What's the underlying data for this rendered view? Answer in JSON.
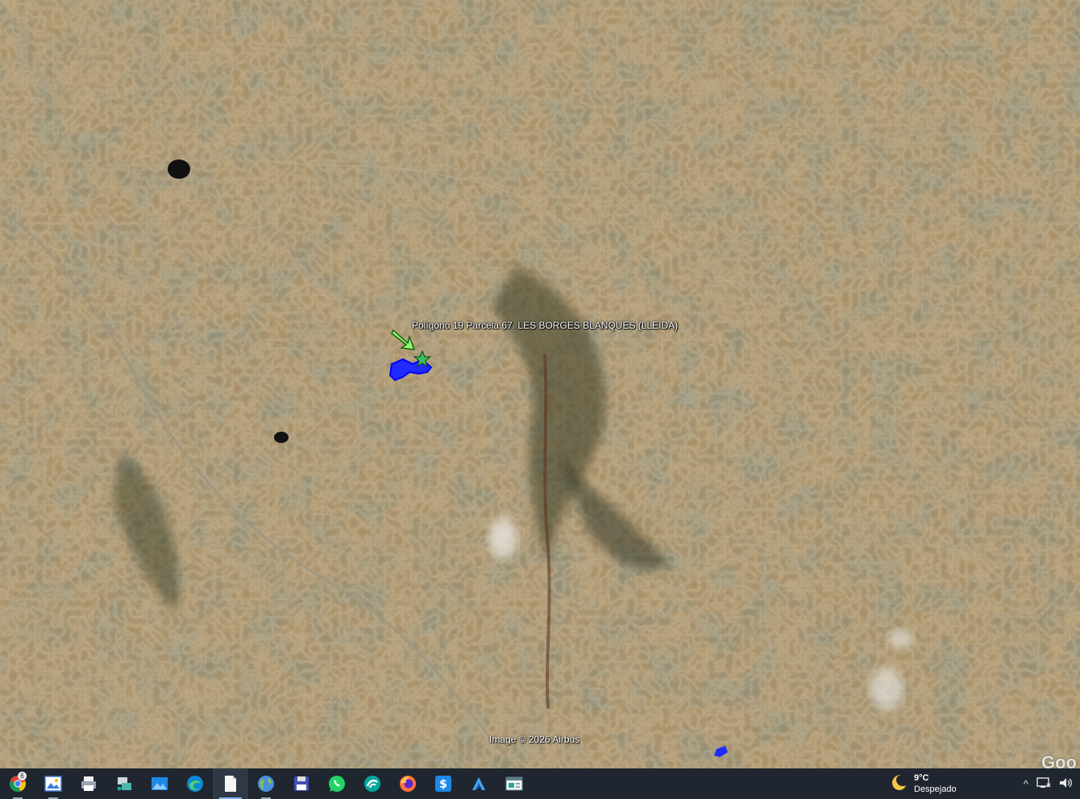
{
  "map": {
    "placemark_label": "Polígono 19 Parcela 67. LES BORGES BLANQUES (LLEIDA)",
    "attribution": "Image © 2026 Airbus",
    "logo_text": "Goo",
    "colors": {
      "parcel": "#1f2bff",
      "arrow": "#6bff5a",
      "terrain": "#a08a62"
    }
  },
  "taskbar": {
    "apps": [
      {
        "name": "Google Chrome",
        "icon": "chrome-icon",
        "badge": "6"
      },
      {
        "name": "Image Viewer",
        "icon": "picture-viewer-icon"
      },
      {
        "name": "Printer",
        "icon": "printer-icon"
      },
      {
        "name": "Network Files",
        "icon": "network-files-icon"
      },
      {
        "name": "Photos",
        "icon": "photos-icon"
      },
      {
        "name": "Microsoft Edge",
        "icon": "edge-icon"
      },
      {
        "name": "Document",
        "icon": "document-icon"
      },
      {
        "name": "Google Earth",
        "icon": "globe-icon"
      },
      {
        "name": "Save",
        "icon": "floppy-icon"
      },
      {
        "name": "WhatsApp",
        "icon": "whatsapp-icon"
      },
      {
        "name": "Signal App",
        "icon": "wave-icon"
      },
      {
        "name": "Firefox",
        "icon": "firefox-icon"
      },
      {
        "name": "Dollar App",
        "icon": "dollar-icon"
      },
      {
        "name": "Arrow App",
        "icon": "arrow-app-icon"
      },
      {
        "name": "Window App",
        "icon": "window-app-icon"
      }
    ],
    "weather": {
      "temp": "9°C",
      "condition": "Despejado",
      "icon": "moon-icon"
    },
    "tray": {
      "chevron": "^",
      "network_icon": "network-icon",
      "volume_icon": "volume-icon"
    }
  }
}
